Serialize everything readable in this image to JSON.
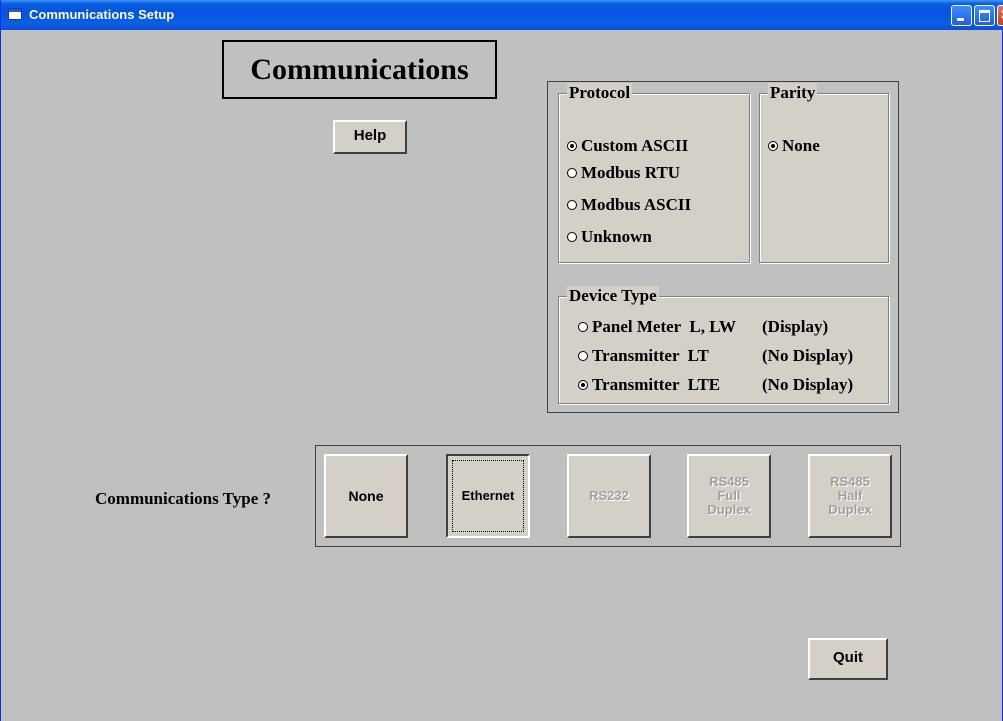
{
  "window": {
    "title": "Communications Setup"
  },
  "heading": "Communications",
  "help_label": "Help",
  "quit_label": "Quit",
  "protocol": {
    "title": "Protocol",
    "options": [
      {
        "label": "Custom ASCII",
        "selected": true
      },
      {
        "label": "Modbus RTU",
        "selected": false
      },
      {
        "label": "Modbus ASCII",
        "selected": false
      },
      {
        "label": "Unknown",
        "selected": false
      }
    ]
  },
  "parity": {
    "title": "Parity",
    "options": [
      {
        "label": "None",
        "selected": true
      }
    ]
  },
  "device_type": {
    "title": "Device Type",
    "options": [
      {
        "name": "Panel Meter  L, LW",
        "display": "(Display)",
        "selected": false
      },
      {
        "name": "Transmitter  LT",
        "display": "(No Display)",
        "selected": false
      },
      {
        "name": "Transmitter  LTE",
        "display": "(No Display)",
        "selected": true
      }
    ]
  },
  "comm_type": {
    "label": "Communications Type ?",
    "buttons": [
      {
        "label": "None",
        "enabled": true,
        "selected": false
      },
      {
        "label": "Ethernet",
        "enabled": true,
        "selected": true
      },
      {
        "label": "RS232",
        "enabled": false,
        "selected": false
      },
      {
        "lines": [
          "RS485",
          "Full",
          "Duplex"
        ],
        "enabled": false,
        "selected": false
      },
      {
        "lines": [
          "RS485",
          "Half",
          "Duplex"
        ],
        "enabled": false,
        "selected": false
      }
    ]
  }
}
